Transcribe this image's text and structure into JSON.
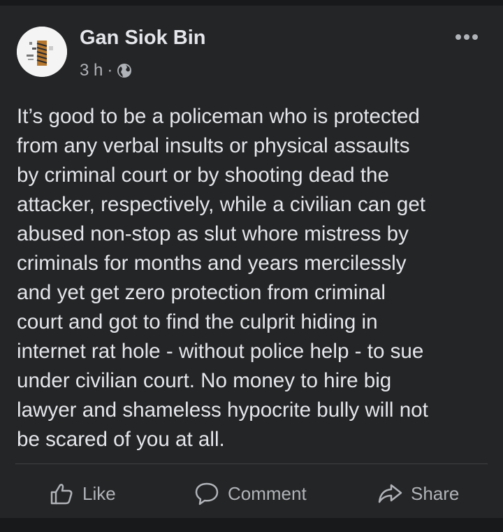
{
  "post": {
    "author": "Gan Siok Bin",
    "time": "3 h",
    "separator": "·",
    "privacy_icon": "globe-icon",
    "menu_icon": "more-horizontal-icon",
    "body": "It’s good to be a policeman who is protected\nfrom any verbal insults or physical assaults\nby criminal court or by shooting dead the\nattacker, respectively, while a civilian can get\nabused non-stop as slut whore mistress by\ncriminals for months and years mercilessly\nand yet get zero protection from criminal\ncourt and got to find the culprit hiding in\ninternet rat hole - without police help - to sue\nunder civilian court. No money to hire big\nlawyer and shameless hypocrite  bully will not\nbe scared of you at all."
  },
  "actions": {
    "like": "Like",
    "comment": "Comment",
    "share": "Share"
  },
  "colors": {
    "background": "#18191a",
    "card": "#242526",
    "text": "#e4e6eb",
    "secondary_text": "#b0b3b8",
    "divider": "#3e4042"
  }
}
